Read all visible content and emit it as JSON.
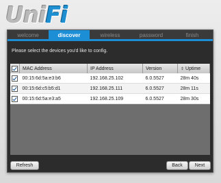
{
  "logo": {
    "part1": "Uni",
    "part2": "Fi"
  },
  "steps": [
    {
      "label": "welcome",
      "active": false
    },
    {
      "label": "discover",
      "active": true
    },
    {
      "label": "wireless",
      "active": false
    },
    {
      "label": "password",
      "active": false
    },
    {
      "label": "finish",
      "active": false
    }
  ],
  "prompt": "Please select the devices you'd like to config.",
  "table": {
    "headers": [
      "MAC Address",
      "IP Address",
      "Version",
      "Uptime"
    ],
    "sort_glyph": "⇕",
    "rows": [
      {
        "mac": "00:15:6d:5a:e3:b6",
        "ip": "192.168.25.102",
        "version": "6.0.5527",
        "uptime": "28m 40s",
        "checked": true
      },
      {
        "mac": "00:15:6d:c5:b5:d1",
        "ip": "192.168.25.111",
        "version": "6.0.5527",
        "uptime": "28m 11s",
        "checked": true
      },
      {
        "mac": "00:15:6d:5a:e3:a5",
        "ip": "192.168.25.109",
        "version": "6.0.5527",
        "uptime": "28m 30s",
        "checked": true
      }
    ]
  },
  "buttons": {
    "refresh": "Refresh",
    "back": "Back",
    "next": "Next"
  },
  "colors": {
    "accent": "#1c8ed6",
    "panel": "#2c2c2c"
  }
}
